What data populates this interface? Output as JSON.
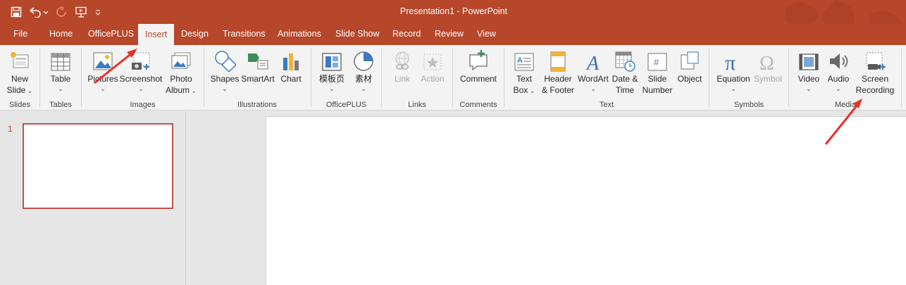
{
  "window": {
    "title": "Presentation1  -  PowerPoint"
  },
  "qat": {
    "icons": [
      "save-icon",
      "undo-icon",
      "redo-icon",
      "start-from-beginning-icon",
      "customize-qat-icon"
    ]
  },
  "tabs": [
    "File",
    "Home",
    "OfficePLUS",
    "Insert",
    "Design",
    "Transitions",
    "Animations",
    "Slide Show",
    "Record",
    "Review",
    "View"
  ],
  "active_tab": "Insert",
  "ribbon": {
    "slides": {
      "label": "Slides",
      "new_slide": [
        "New",
        "Slide"
      ]
    },
    "tables": {
      "label": "Tables",
      "table": "Table"
    },
    "images": {
      "label": "Images",
      "pictures": "Pictures",
      "screenshot": "Screenshot",
      "photo_album": [
        "Photo",
        "Album"
      ]
    },
    "illustrations": {
      "label": "Illustrations",
      "shapes": "Shapes",
      "smartart": "SmartArt",
      "chart": "Chart"
    },
    "officeplus": {
      "label": "OfficePLUS",
      "template_page": "模板页",
      "materials": "素材"
    },
    "links": {
      "label": "Links",
      "link": "Link",
      "action": "Action"
    },
    "comments": {
      "label": "Comments",
      "comment": "Comment"
    },
    "text": {
      "label": "Text",
      "text_box": [
        "Text",
        "Box"
      ],
      "header_footer": [
        "Header",
        "& Footer"
      ],
      "wordart": "WordArt",
      "date_time": [
        "Date &",
        "Time"
      ],
      "slide_number": [
        "Slide",
        "Number"
      ],
      "object": "Object"
    },
    "symbols": {
      "label": "Symbols",
      "equation": "Equation",
      "symbol": "Symbol"
    },
    "media": {
      "label": "Media",
      "video": "Video",
      "audio": "Audio",
      "screen_recording": [
        "Screen",
        "Recording"
      ]
    }
  },
  "thumbnails": [
    {
      "number": "1"
    }
  ],
  "colors": {
    "accent": "#b7472a",
    "ribbon_bg": "#f3f3f3",
    "selected_thumb_border": "#c0504d",
    "arrow": "#e8312a"
  }
}
